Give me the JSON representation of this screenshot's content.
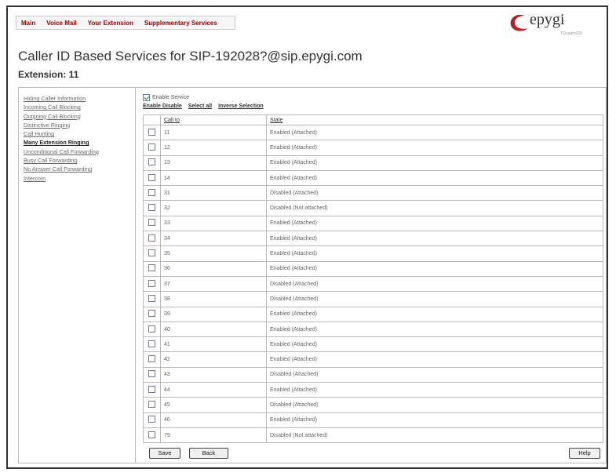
{
  "nav": [
    "Main",
    "Voice Mail",
    "Your Extension",
    "Supplementary Services"
  ],
  "logo": {
    "brand": "epygi",
    "model": "TQuadro226"
  },
  "page_title": "Caller ID Based Services for SIP-192028?@sip.epygi.com",
  "extension_label": "Extension: 11",
  "sidebar": [
    {
      "label": "Hiding Caller Information",
      "active": false
    },
    {
      "label": "Incoming Call Blocking",
      "active": false
    },
    {
      "label": "Outgoing Call Blocking",
      "active": false
    },
    {
      "label": "Distinctive Ringing",
      "active": false
    },
    {
      "label": "Call Hunting",
      "active": false
    },
    {
      "label": "Many Extension Ringing",
      "active": true
    },
    {
      "label": "Unconditional Call Forwarding",
      "active": false
    },
    {
      "label": "Busy Call Forwarding",
      "active": false
    },
    {
      "label": "No Answer Call Forwarding",
      "active": false
    },
    {
      "label": "Intercom",
      "active": false
    }
  ],
  "enable_service": {
    "label": "Enable Service",
    "checked": true
  },
  "select_links": [
    "Enable Disable",
    "Select all",
    "Inverse Selection"
  ],
  "table": {
    "headers": [
      "Call to",
      "State"
    ],
    "rows": [
      {
        "call_to": "11",
        "state": "Enabled (Attached)"
      },
      {
        "call_to": "12",
        "state": "Enabled (Attached)"
      },
      {
        "call_to": "13",
        "state": "Enabled (Attached)"
      },
      {
        "call_to": "14",
        "state": "Enabled (Attached)"
      },
      {
        "call_to": "31",
        "state": "Disabled (Attached)"
      },
      {
        "call_to": "32",
        "state": "Disabled (Not attached)"
      },
      {
        "call_to": "33",
        "state": "Enabled (Attached)"
      },
      {
        "call_to": "34",
        "state": "Enabled (Attached)"
      },
      {
        "call_to": "35",
        "state": "Enabled (Attached)"
      },
      {
        "call_to": "36",
        "state": "Enabled (Attached)"
      },
      {
        "call_to": "37",
        "state": "Disabled (Attached)"
      },
      {
        "call_to": "38",
        "state": "Disabled (Attached)"
      },
      {
        "call_to": "39",
        "state": "Enabled (Attached)"
      },
      {
        "call_to": "40",
        "state": "Enabled (Attached)"
      },
      {
        "call_to": "41",
        "state": "Enabled (Attached)"
      },
      {
        "call_to": "42",
        "state": "Enabled (Attached)"
      },
      {
        "call_to": "43",
        "state": "Disabled (Attached)"
      },
      {
        "call_to": "44",
        "state": "Enabled (Attached)"
      },
      {
        "call_to": "45",
        "state": "Disabled (Attached)"
      },
      {
        "call_to": "46",
        "state": "Enabled (Attached)"
      },
      {
        "call_to": "79",
        "state": "Disabled (Not attached)"
      }
    ]
  },
  "buttons": {
    "save": "Save",
    "back": "Back",
    "help": "Help"
  },
  "colors": {
    "nav_link": "#a00000",
    "logo_red": "#c0191f"
  }
}
